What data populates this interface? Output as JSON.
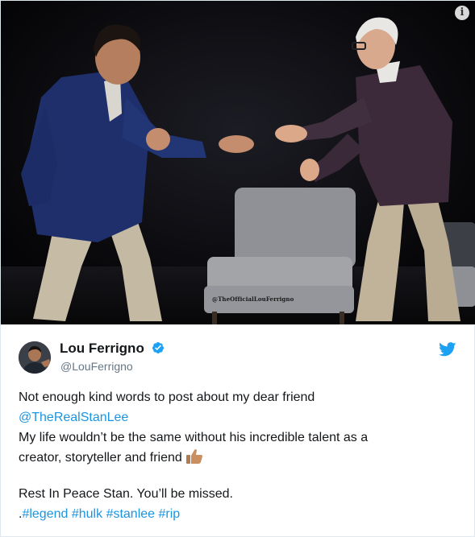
{
  "photo": {
    "alt": "Lou Ferrigno and Stan Lee on stage",
    "watermark": "@TheOfficialLouFerrigno",
    "info_icon": "info-icon"
  },
  "author": {
    "name": "Lou Ferrigno",
    "handle": "@LouFerrigno",
    "verified": true
  },
  "tweet": {
    "line1": "Not enough kind words to post about my dear friend",
    "mention": "@TheRealStanLee",
    "line3": "My life wouldn’t be the same without his incredible talent as a",
    "line4": "creator, storyteller and friend",
    "line5": "Rest In Peace Stan. You’ll be missed.",
    "prefix": ".",
    "hashtags": [
      "#legend",
      "#hulk",
      "#stanlee",
      "#rip"
    ]
  },
  "colors": {
    "link": "#1b95e0",
    "twitter_blue": "#1da1f2",
    "text": "#14171a",
    "secondary": "#657786"
  }
}
